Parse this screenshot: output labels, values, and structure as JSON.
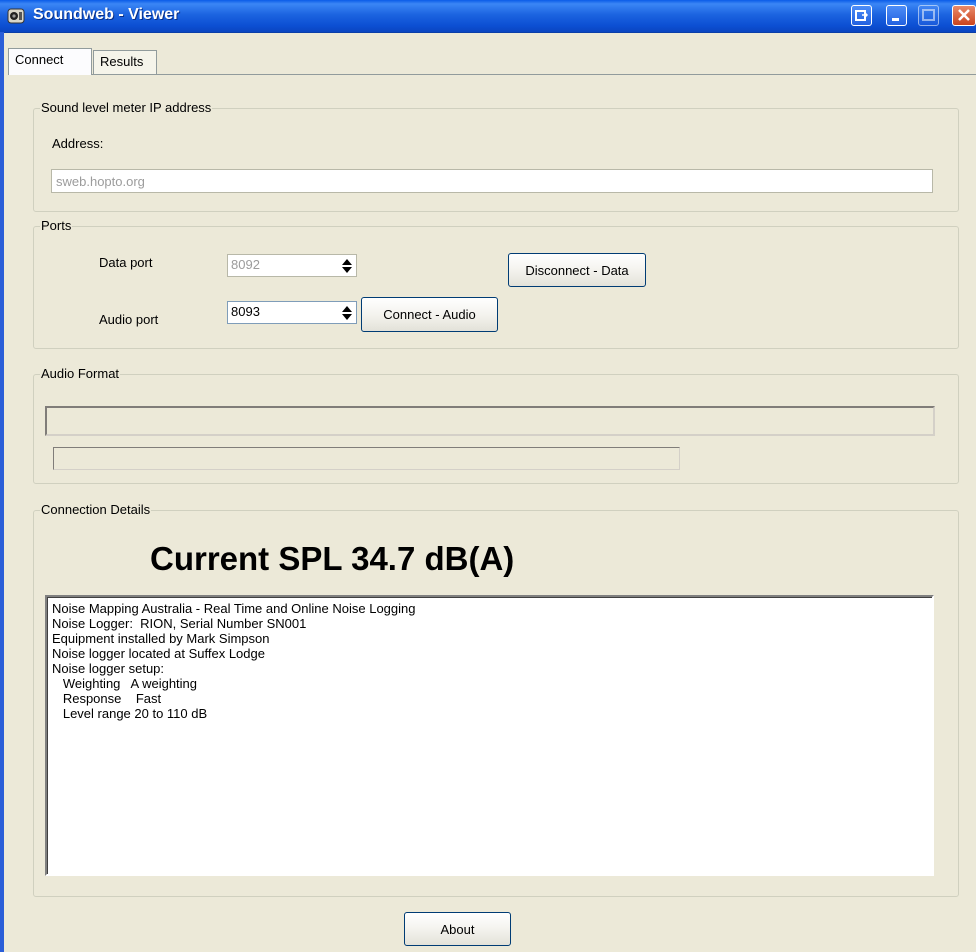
{
  "window": {
    "title": "Soundweb - Viewer"
  },
  "tabs": [
    {
      "label": "Connect",
      "active": true
    },
    {
      "label": "Results",
      "active": false
    }
  ],
  "ip_group": {
    "legend": "Sound level meter IP address",
    "address_label": "Address:",
    "address_value": "sweb.hopto.org"
  },
  "ports_group": {
    "legend": "Ports",
    "data_port_label": "Data port",
    "data_port_value": "8092",
    "audio_port_label": "Audio port",
    "audio_port_value": "8093",
    "disconnect_data_label": "Disconnect - Data",
    "connect_audio_label": "Connect - Audio"
  },
  "audio_format_group": {
    "legend": "Audio Format",
    "format_line1": "",
    "format_line2": ""
  },
  "connection_details": {
    "legend": "Connection Details",
    "current_spl": "Current SPL 34.7 dB(A)",
    "text": "Noise Mapping Australia - Real Time and Online Noise Logging\nNoise Logger:  RION, Serial Number SN001\nEquipment installed by Mark Simpson\nNoise logger located at Suffex Lodge\nNoise logger setup:\n   Weighting   A weighting\n   Response    Fast\n   Level range 20 to 110 dB"
  },
  "about_label": "About",
  "colors": {
    "titlebar": "#0c4fd3",
    "window_bg": "#ece9d8",
    "button_border": "#003c74"
  }
}
